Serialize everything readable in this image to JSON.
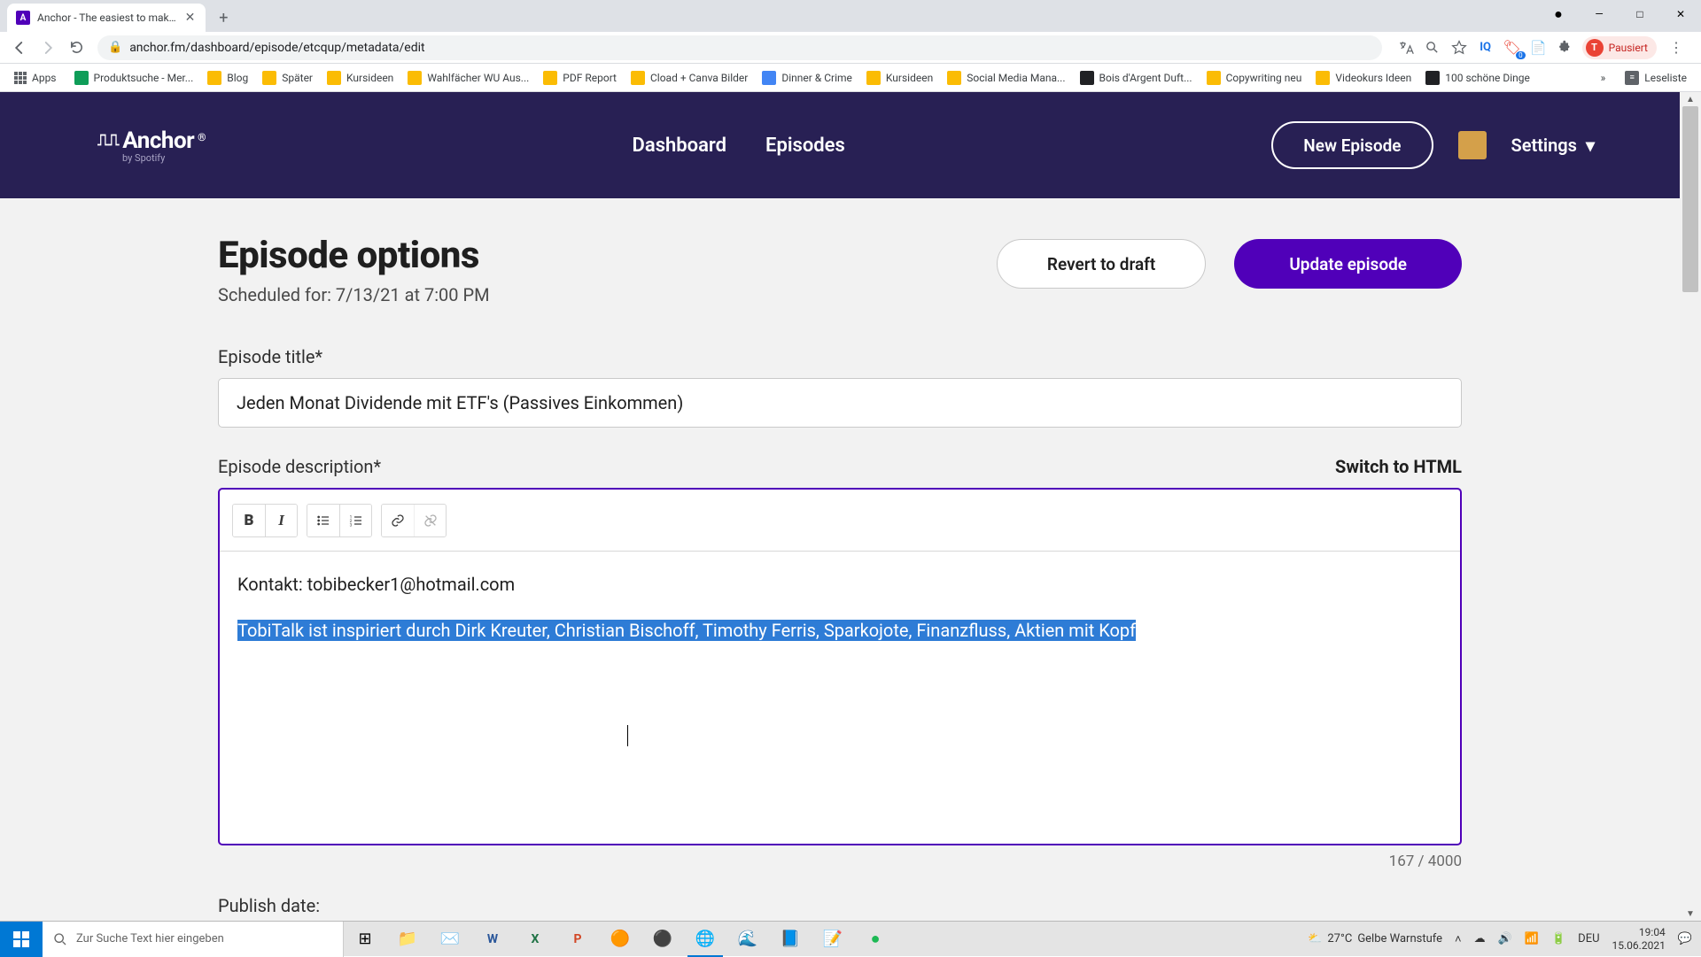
{
  "browser": {
    "tab_title": "Anchor - The easiest to mak…",
    "url": "anchor.fm/dashboard/episode/etcqup/metadata/edit",
    "profile_status": "Pausiert",
    "profile_initial": "T",
    "window_controls": {
      "min": "—",
      "max": "□",
      "close": "✕"
    },
    "addr_icons": {
      "translate": "⠀",
      "zoom": "🔍",
      "star": "☆"
    },
    "bookmarks_apps": "Apps",
    "bookmarks": [
      {
        "label": "Produktsuche - Mer...",
        "color": "#0f9d58"
      },
      {
        "label": "Blog",
        "color": "#fbbc04"
      },
      {
        "label": "Später",
        "color": "#fbbc04"
      },
      {
        "label": "Kursideen",
        "color": "#fbbc04"
      },
      {
        "label": "Wahlfächer WU Aus...",
        "color": "#fbbc04"
      },
      {
        "label": "PDF Report",
        "color": "#fbbc04"
      },
      {
        "label": "Cload + Canva Bilder",
        "color": "#fbbc04"
      },
      {
        "label": "Dinner & Crime",
        "color": "#4285f4"
      },
      {
        "label": "Kursideen",
        "color": "#fbbc04"
      },
      {
        "label": "Social Media Mana...",
        "color": "#fbbc04"
      },
      {
        "label": "Bois d'Argent Duft...",
        "color": "#202124"
      },
      {
        "label": "Copywriting neu",
        "color": "#fbbc04"
      },
      {
        "label": "Videokurs Ideen",
        "color": "#fbbc04"
      },
      {
        "label": "100 schöne Dinge",
        "color": "#202124"
      }
    ],
    "reading_list": "Leseliste"
  },
  "header": {
    "logo_text": "Anchor",
    "logo_sub": "by Spotify",
    "nav": {
      "dashboard": "Dashboard",
      "episodes": "Episodes"
    },
    "new_episode": "New Episode",
    "settings": "Settings"
  },
  "page": {
    "title": "Episode options",
    "scheduled": "Scheduled for: 7/13/21 at 7:00 PM",
    "revert_btn": "Revert to draft",
    "update_btn": "Update episode",
    "title_label": "Episode title*",
    "title_value": "Jeden Monat Dividende mit ETF's (Passives Einkommen)",
    "desc_label": "Episode description*",
    "switch_html": "Switch to HTML",
    "desc_line1": "Kontakt: tobibecker1@hotmail.com",
    "desc_line2": "TobiTalk ist inspiriert durch Dirk Kreuter, Christian Bischoff, Timothy Ferris, Sparkojote, Finanzfluss, Aktien mit Kopf",
    "char_count": "167 / 4000",
    "publish_label": "Publish date:"
  },
  "taskbar": {
    "search_placeholder": "Zur Suche Text hier eingeben",
    "weather_temp": "27°C",
    "weather_text": "Gelbe Warnstufe",
    "lang": "DEU",
    "time": "19:04",
    "date": "15.06.2021"
  }
}
